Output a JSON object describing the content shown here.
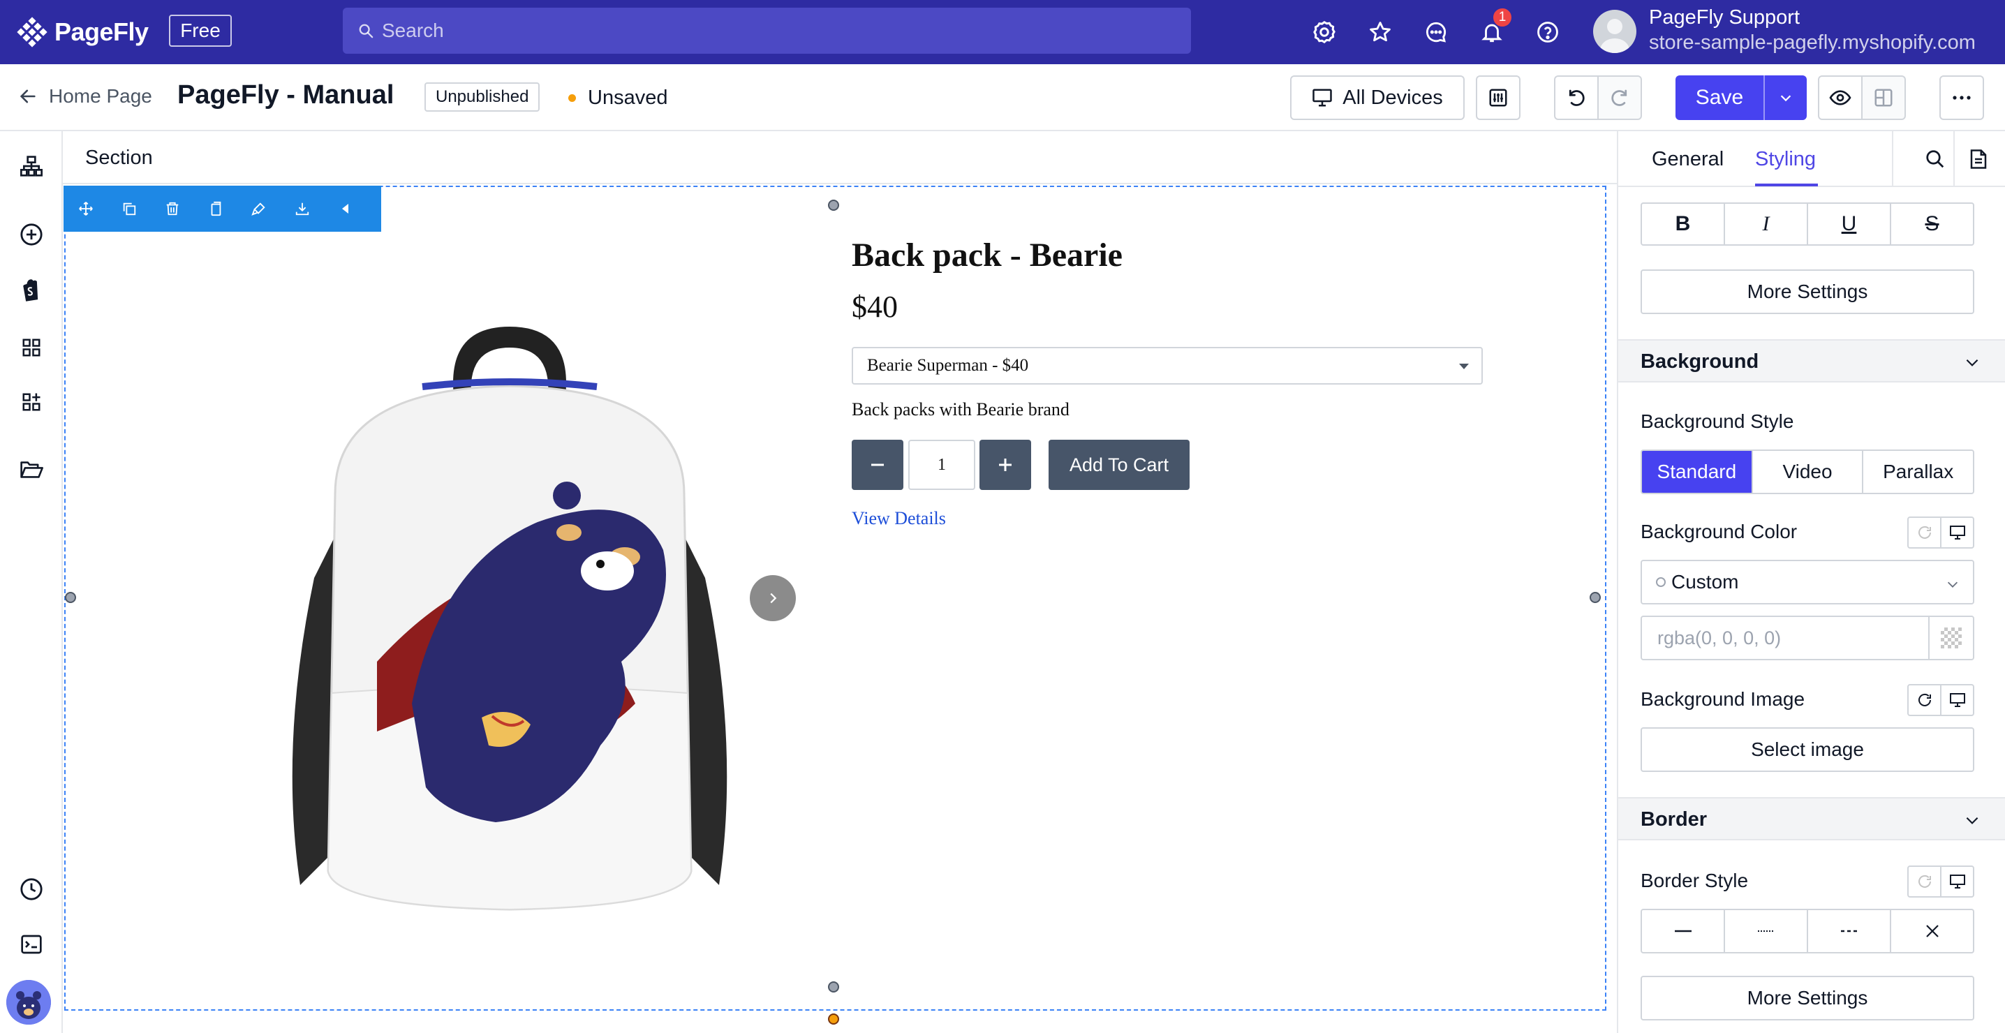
{
  "topbar": {
    "brand": "PageFly",
    "plan_badge": "Free",
    "search_placeholder": "Search",
    "notification_count": "1",
    "user_name": "PageFly Support",
    "user_store": "store-sample-pagefly.myshopify.com",
    "icons": [
      "gear-icon",
      "star-icon",
      "chat-icon",
      "bell-icon",
      "help-icon"
    ]
  },
  "header": {
    "back_label": "Home Page",
    "page_title": "PageFly - Manual",
    "status": "Unpublished",
    "save_state": "Unsaved",
    "devices_label": "All Devices",
    "save_label": "Save"
  },
  "canvas": {
    "section_label": "Section",
    "product": {
      "title": "Back pack - Bearie",
      "price": "$40",
      "variant_selected": "Bearie Superman - $40",
      "description": "Back packs with Bearie brand",
      "quantity": "1",
      "add_to_cart": "Add To Cart",
      "view_details": "View Details"
    }
  },
  "panel": {
    "tabs": [
      "General",
      "Styling"
    ],
    "active_tab": "Styling",
    "text_format_buttons": [
      "B",
      "I",
      "U",
      "S"
    ],
    "more_settings": "More Settings",
    "background": {
      "title": "Background",
      "style_label": "Background Style",
      "style_options": [
        "Standard",
        "Video",
        "Parallax"
      ],
      "style_selected": "Standard",
      "color_label": "Background Color",
      "color_mode": "Custom",
      "color_placeholder": "rgba(0, 0, 0, 0)",
      "image_label": "Background Image",
      "select_image": "Select image"
    },
    "border": {
      "title": "Border",
      "style_label": "Border Style",
      "more_settings": "More Settings"
    }
  },
  "colors": {
    "topbar_bg": "#2e2ba2",
    "accent": "#4742f0",
    "selection": "#3b82f6",
    "element_toolbar": "#1e88e5",
    "cart_button": "#475569",
    "link": "#1d4ed8"
  }
}
